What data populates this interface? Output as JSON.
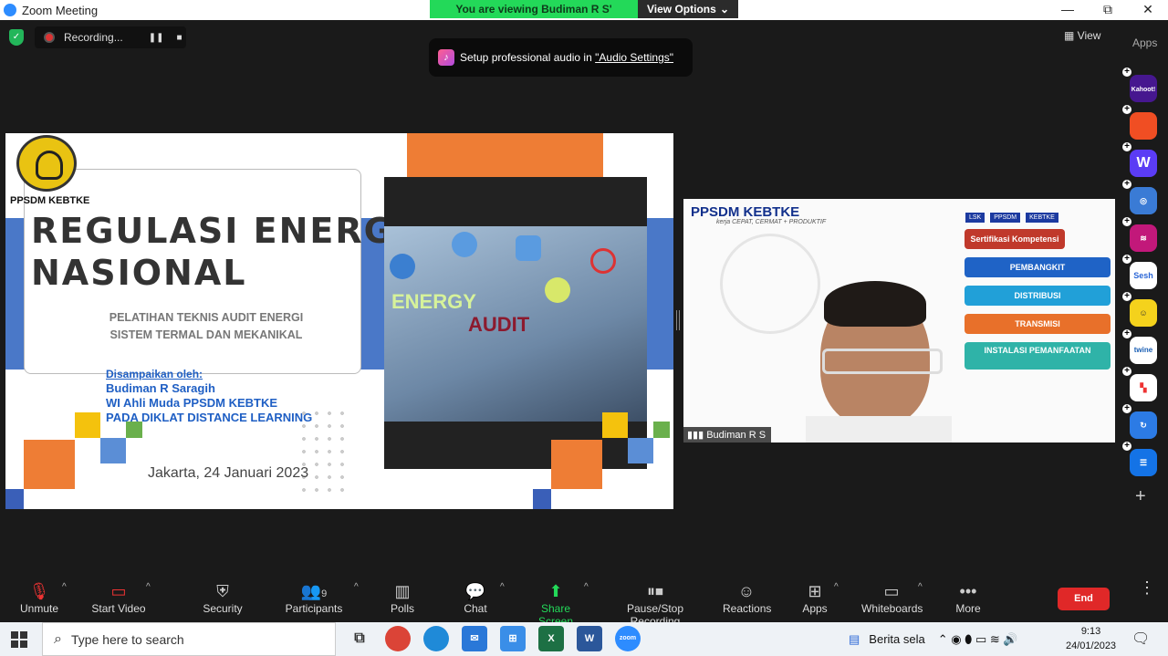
{
  "window": {
    "title": "Zoom Meeting",
    "minimize": "—",
    "restore": "⧉",
    "close": "✕"
  },
  "banner": {
    "viewing": "You are viewing Budiman R S' screen",
    "view_options": "View Options",
    "chev": "⌄"
  },
  "recording": {
    "label": "Recording...",
    "pause": "❚❚",
    "stop": "■"
  },
  "toast": {
    "prefix": "Setup professional audio in ",
    "link": "\"Audio Settings\""
  },
  "top_right": {
    "view": "View",
    "apps": "Apps"
  },
  "slide": {
    "org": "PPSDM KEBTKE",
    "title_line1": "REGULASI ENERGI",
    "title_line2": "NASIONAL",
    "subtitle_line1": "PELATIHAN TEKNIS AUDIT ENERGI",
    "subtitle_line2": "SISTEM TERMAL DAN MEKANIKAL",
    "presented_by": "Disampaikan oleh:",
    "presenter_name": "Budiman R Saragih",
    "presenter_role": "WI Ahli Muda PPSDM KEBTKE",
    "presenter_event": "PADA DIKLAT DISTANCE LEARNING",
    "date": "Jakarta, 24 Januari 2023",
    "photo_word1": "ENERGY",
    "photo_word2": "AUDIT"
  },
  "video": {
    "header": "PPSDM KEBTKE",
    "tagline": "kerja CEPAT, CERMAT + PRODUKTIF",
    "tags": [
      "LSK",
      "PPSDM",
      "KEBTKE"
    ],
    "items": [
      "Sertifikasi Kompetensi",
      "PEMBANGKIT",
      "DISTRIBUSI",
      "TRANSMISI",
      "INSTALASI PEMANFAATAN"
    ],
    "participant_name": "Budiman R S"
  },
  "toolbar": {
    "unmute": "Unmute",
    "start_video": "Start Video",
    "security": "Security",
    "participants": "Participants",
    "participants_count": "9",
    "polls": "Polls",
    "chat": "Chat",
    "share_screen": "Share Screen",
    "pause_stop": "Pause/Stop Recording",
    "reactions": "Reactions",
    "apps": "Apps",
    "whiteboards": "Whiteboards",
    "more": "More",
    "end": "End"
  },
  "taskbar": {
    "search_placeholder": "Type here to search",
    "news": "Berita sela",
    "time": "9:13",
    "date": "24/01/2023"
  },
  "apps_sidebar": [
    "Kahoot!",
    "",
    "W",
    "",
    "",
    "Sesh",
    "",
    "twine",
    "",
    "",
    ""
  ]
}
